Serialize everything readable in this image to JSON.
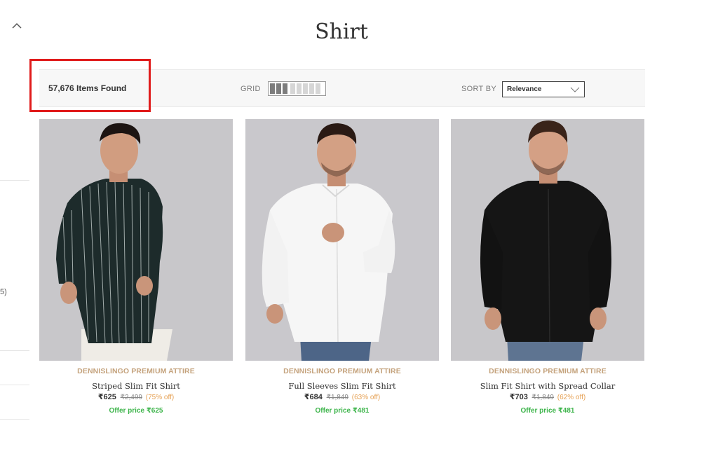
{
  "sidebar": {
    "partial_count": "5)"
  },
  "page": {
    "title": "Shirt"
  },
  "toolbar": {
    "items_found": "57,676 Items Found",
    "grid_label": "GRID",
    "sort_label": "SORT BY",
    "sort_value": "Relevance"
  },
  "colors": {
    "brand_text": "#c4a27c",
    "offer_text": "#3cb44a",
    "discount_text": "#e6a154",
    "highlight_box": "#e01b1b"
  },
  "products": [
    {
      "brand": "DENNISLINGO PREMIUM ATTIRE",
      "name": "Striped Slim Fit Shirt",
      "price": "₹625",
      "mrp": "₹2,499",
      "discount": "(75% off)",
      "offer": "Offer price ₹625",
      "shirt_color": "#1d2b2b"
    },
    {
      "brand": "DENNISLINGO PREMIUM ATTIRE",
      "name": "Full Sleeves Slim Fit Shirt",
      "price": "₹684",
      "mrp": "₹1,849",
      "discount": "(63% off)",
      "offer": "Offer price ₹481",
      "shirt_color": "#f6f6f6"
    },
    {
      "brand": "DENNISLINGO PREMIUM ATTIRE",
      "name": "Slim Fit Shirt with Spread Collar",
      "price": "₹703",
      "mrp": "₹1,849",
      "discount": "(62% off)",
      "offer": "Offer price ₹481",
      "shirt_color": "#151515"
    }
  ]
}
